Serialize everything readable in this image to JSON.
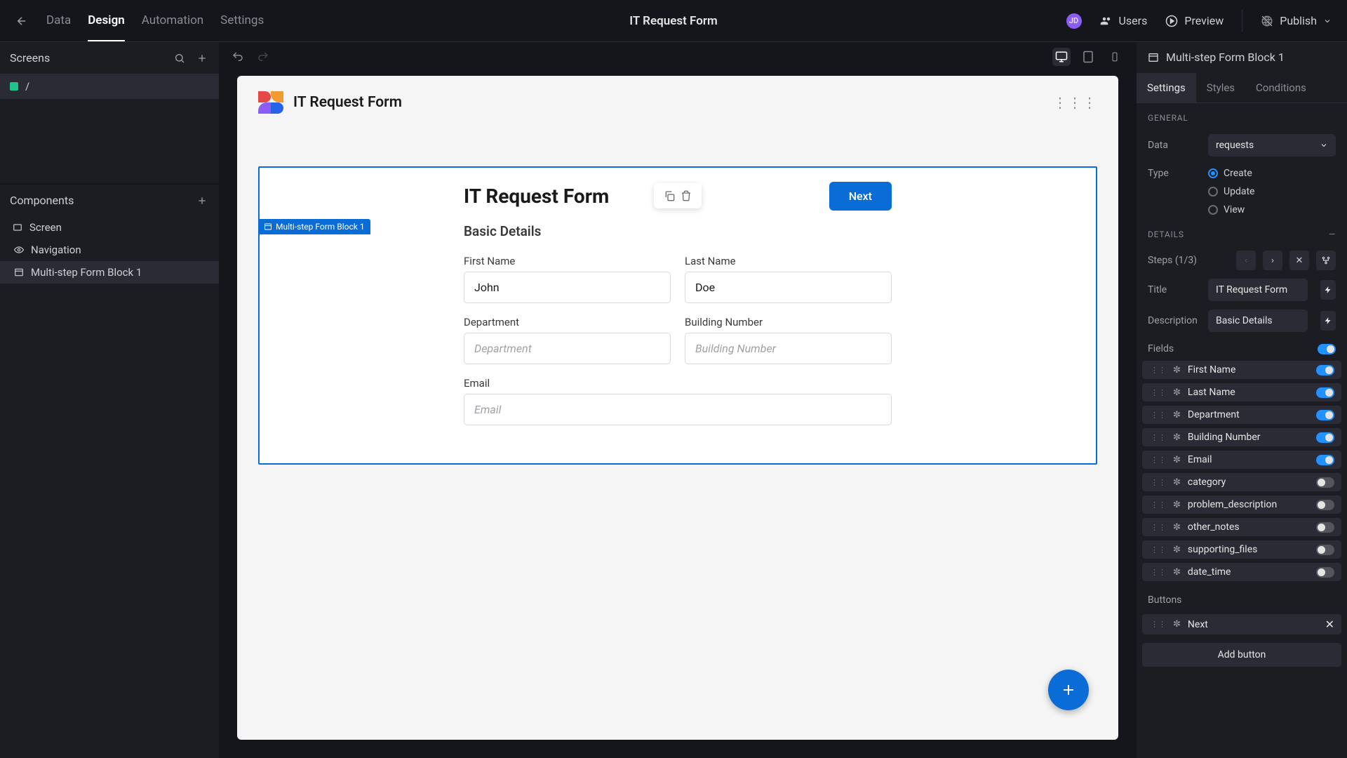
{
  "topbar": {
    "nav": {
      "data": "Data",
      "design": "Design",
      "automation": "Automation",
      "settings": "Settings"
    },
    "title": "IT Request Form",
    "avatar": "JD",
    "users": "Users",
    "preview": "Preview",
    "publish": "Publish"
  },
  "left": {
    "screens_label": "Screens",
    "screen_root": "/",
    "components_label": "Components",
    "items": {
      "screen": "Screen",
      "navigation": "Navigation",
      "multistep": "Multi-step Form Block 1"
    }
  },
  "canvas": {
    "app_title": "IT Request Form",
    "block_tag": "Multi-step Form Block 1",
    "form_title": "IT Request Form",
    "next": "Next",
    "subtitle": "Basic Details",
    "fields": {
      "first_name": {
        "label": "First Name",
        "value": "John"
      },
      "last_name": {
        "label": "Last Name",
        "value": "Doe"
      },
      "department": {
        "label": "Department",
        "placeholder": "Department"
      },
      "building": {
        "label": "Building Number",
        "placeholder": "Building Number"
      },
      "email": {
        "label": "Email",
        "placeholder": "Email"
      }
    }
  },
  "right": {
    "head": "Multi-step Form Block 1",
    "tabs": {
      "settings": "Settings",
      "styles": "Styles",
      "conditions": "Conditions"
    },
    "general_label": "GENERAL",
    "data_label": "Data",
    "data_value": "requests",
    "type_label": "Type",
    "type_opts": {
      "create": "Create",
      "update": "Update",
      "view": "View"
    },
    "details_label": "DETAILS",
    "steps_label": "Steps (1/3)",
    "title_label": "Title",
    "title_value": "IT Request Form",
    "desc_label": "Description",
    "desc_value": "Basic Details",
    "fields_label": "Fields",
    "field_list": {
      "0": "First Name",
      "1": "Last Name",
      "2": "Department",
      "3": "Building Number",
      "4": "Email",
      "5": "category",
      "6": "problem_description",
      "7": "other_notes",
      "8": "supporting_files",
      "9": "date_time"
    },
    "buttons_label": "Buttons",
    "button_next": "Next",
    "add_button": "Add button"
  }
}
